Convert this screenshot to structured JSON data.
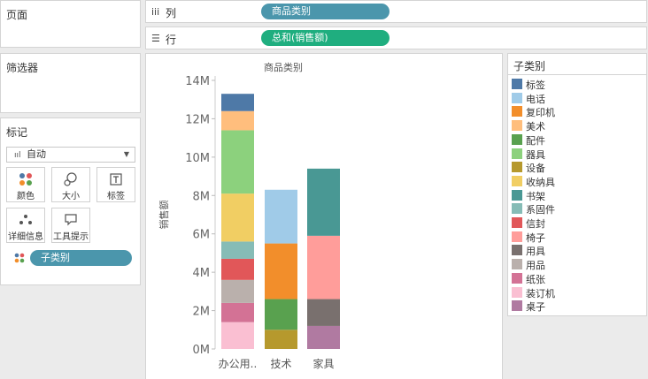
{
  "panels": {
    "pages_title": "页面",
    "filters_title": "筛选器",
    "marks_title": "标记"
  },
  "shelves": {
    "columns": {
      "icon": "iii",
      "label": "列",
      "pill": "商品类别",
      "pill_color": "#4b96ac"
    },
    "rows": {
      "icon": "☰",
      "label": "行",
      "pill": "总和(销售额)",
      "pill_color": "#1fae7f"
    }
  },
  "marks": {
    "mark_type": "自动",
    "buttons": [
      "颜色",
      "大小",
      "标签",
      "详细信息",
      "工具提示"
    ],
    "field_pill": "子类别",
    "field_pill_color": "#4b96ac"
  },
  "legend": {
    "title": "子类别",
    "items": [
      {
        "name": "标签",
        "color": "#4e79a7"
      },
      {
        "name": "电话",
        "color": "#a0cbe8"
      },
      {
        "name": "复印机",
        "color": "#f28e2b"
      },
      {
        "name": "美术",
        "color": "#ffbe7d"
      },
      {
        "name": "配件",
        "color": "#59a14f"
      },
      {
        "name": "器具",
        "color": "#8cd17d"
      },
      {
        "name": "设备",
        "color": "#b6992d"
      },
      {
        "name": "收纳具",
        "color": "#f1ce63"
      },
      {
        "name": "书架",
        "color": "#499894"
      },
      {
        "name": "系固件",
        "color": "#86bcb6"
      },
      {
        "name": "信封",
        "color": "#e15759"
      },
      {
        "name": "椅子",
        "color": "#ff9d9a"
      },
      {
        "name": "用具",
        "color": "#79706e"
      },
      {
        "name": "用品",
        "color": "#bab0ac"
      },
      {
        "name": "纸张",
        "color": "#d37295"
      },
      {
        "name": "装订机",
        "color": "#fabfd2"
      },
      {
        "name": "桌子",
        "color": "#b07aa1"
      }
    ]
  },
  "chart_data": {
    "type": "bar",
    "stacked": true,
    "title": "商品类别",
    "ylabel": "销售额",
    "ylim": [
      0,
      14000000
    ],
    "y_ticks": [
      "0M",
      "2M",
      "4M",
      "6M",
      "8M",
      "10M",
      "12M",
      "14M"
    ],
    "y_tick_values": [
      0,
      2000000,
      4000000,
      6000000,
      8000000,
      10000000,
      12000000,
      14000000
    ],
    "categories": [
      "办公用..",
      "技术",
      "家具"
    ],
    "series": [
      {
        "name": "装订机",
        "values": [
          1400000,
          0,
          0
        ]
      },
      {
        "name": "纸张",
        "values": [
          1000000,
          0,
          0
        ]
      },
      {
        "name": "用品",
        "values": [
          1200000,
          0,
          0
        ]
      },
      {
        "name": "信封",
        "values": [
          1100000,
          0,
          0
        ]
      },
      {
        "name": "系固件",
        "values": [
          900000,
          0,
          0
        ]
      },
      {
        "name": "收纳具",
        "values": [
          2500000,
          0,
          0
        ]
      },
      {
        "name": "器具",
        "values": [
          3300000,
          0,
          0
        ]
      },
      {
        "name": "美术",
        "values": [
          1000000,
          0,
          0
        ]
      },
      {
        "name": "标签",
        "values": [
          900000,
          0,
          0
        ]
      },
      {
        "name": "设备",
        "values": [
          0,
          1000000,
          0
        ]
      },
      {
        "name": "配件",
        "values": [
          0,
          1600000,
          0
        ]
      },
      {
        "name": "复印机",
        "values": [
          0,
          2900000,
          0
        ]
      },
      {
        "name": "电话",
        "values": [
          0,
          2800000,
          0
        ]
      },
      {
        "name": "桌子",
        "values": [
          0,
          0,
          1200000
        ]
      },
      {
        "name": "用具",
        "values": [
          0,
          0,
          1400000
        ]
      },
      {
        "name": "椅子",
        "values": [
          0,
          0,
          3300000
        ]
      },
      {
        "name": "书架",
        "values": [
          0,
          0,
          3500000
        ]
      }
    ]
  }
}
